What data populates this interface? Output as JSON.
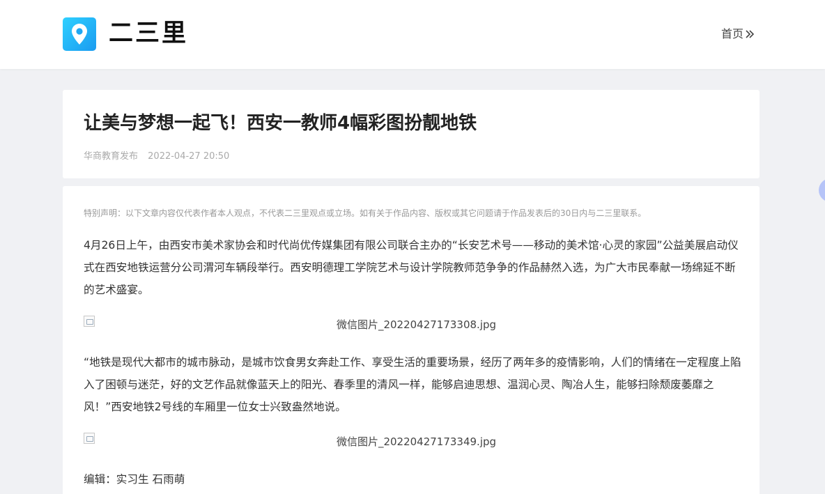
{
  "header": {
    "site_name": "二三里",
    "home_label": "首页",
    "brand_color": "#1fa7f2"
  },
  "article": {
    "title": "让美与梦想一起飞！西安一教师4幅彩图扮靓地铁",
    "source": "华商教育发布",
    "date": "2022-04-27 20:50",
    "disclaimer": "特别声明：以下文章内容仅代表作者本人观点，不代表二三里观点或立场。如有关于作品内容、版权或其它问题请于作品发表后的30日内与二三里联系。",
    "paragraphs": [
      "4月26日上午，由西安市美术家协会和时代尚优传媒集团有限公司联合主办的“长安艺术号——移动的美术馆·心灵的家园”公益美展启动仪式在西安地铁运营分公司渭河车辆段举行。西安明德理工学院艺术与设计学院教师范争争的作品赫然入选，为广大市民奉献一场绵延不断的艺术盛宴。",
      "“地铁是现代大都市的城市脉动，是城市饮食男女奔赴工作、享受生活的重要场景，经历了两年多的疫情影响，人们的情绪在一定程度上陷入了困顿与迷茫，好的文艺作品就像蓝天上的阳光、春季里的清风一样，能够启迪思想、温润心灵、陶冶人生，能够扫除颓废萎靡之风！”西安地铁2号线的车厢里一位女士兴致盎然地说。"
    ],
    "images": [
      {
        "caption": "微信图片_20220427173308.jpg"
      },
      {
        "caption": "微信图片_20220427173349.jpg"
      }
    ],
    "editor": "编辑：实习生 石雨萌"
  },
  "icons": {
    "logo": "map-pin-icon",
    "home_arrow": "double-chevron-right-icon",
    "broken_image": "broken-image-icon"
  }
}
